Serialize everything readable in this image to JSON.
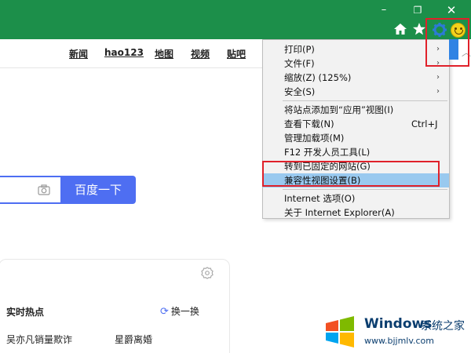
{
  "window_controls": {
    "minimize": "–",
    "maximize": "❐",
    "close": "✕"
  },
  "toolbar_icons": [
    "home-icon",
    "star-icon",
    "gear-icon",
    "smiley-icon"
  ],
  "nav_links": [
    "新闻",
    "hao123",
    "地图",
    "视频",
    "贴吧"
  ],
  "search": {
    "button_label": "百度一下"
  },
  "hot_panel": {
    "title": "实时热点",
    "refresh_label": "换一换",
    "items": [
      "吴亦凡销量欺诈",
      "星爵离婚"
    ]
  },
  "menu": {
    "items": [
      {
        "label": "打印(P)",
        "arrow": "›"
      },
      {
        "label": "文件(F)",
        "arrow": "›"
      },
      {
        "label": "缩放(Z) (125%)",
        "arrow": "›"
      },
      {
        "label": "安全(S)",
        "arrow": "›"
      },
      {
        "label": "将站点添加到“应用”视图(I)"
      },
      {
        "label": "查看下载(N)",
        "shortcut": "Ctrl+J"
      },
      {
        "label": "管理加载项(M)"
      },
      {
        "label": "F12 开发人员工具(L)"
      },
      {
        "label": "转到已固定的网站(G)"
      },
      {
        "label": "兼容性视图设置(B)",
        "highlighted": true
      },
      {
        "label": "Internet 选项(O)"
      },
      {
        "label": "关于 Internet Explorer(A)"
      }
    ]
  },
  "watermark": {
    "brand": "Windows",
    "brand_cn": "系统之家",
    "url": "www.bjjmlv.com"
  },
  "colors": {
    "titlebar": "#1c8f4a",
    "search_accent": "#4e6ef2",
    "menu_highlight": "#99c9ef",
    "callout_red": "#e0212a"
  }
}
